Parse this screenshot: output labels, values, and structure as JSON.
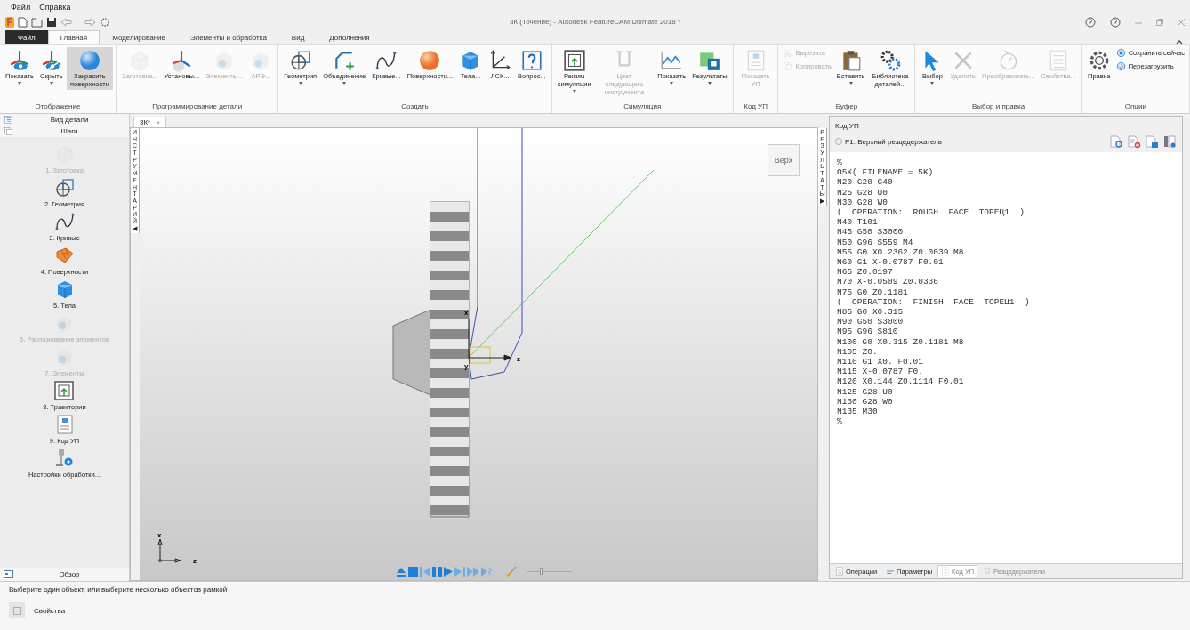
{
  "menu": [
    "Файл",
    "Справка"
  ],
  "window": {
    "title": "3К (Точение) - Autodesk FeatureCAM Ultimate 2018 *"
  },
  "ribbon_tabs": [
    {
      "label": "Файл",
      "kind": "file",
      "selected": false
    },
    {
      "label": "Главная",
      "kind": "tab",
      "selected": true
    },
    {
      "label": "Моделирование",
      "kind": "tab",
      "selected": false
    },
    {
      "label": "Элементы и обработка",
      "kind": "tab",
      "selected": false
    },
    {
      "label": "Вид",
      "kind": "tab",
      "selected": false
    },
    {
      "label": "Дополнения",
      "kind": "tab",
      "selected": false
    }
  ],
  "ribbon_groups": [
    {
      "label": "Отображение",
      "buttons": [
        {
          "label": "Показать",
          "kind": "large",
          "dropdown": true,
          "disabled": false,
          "pressed": false
        },
        {
          "label": "Скрыть",
          "kind": "large",
          "dropdown": true,
          "disabled": false,
          "pressed": false
        },
        {
          "label": "Закрасить поверхности",
          "kind": "large",
          "dropdown": false,
          "disabled": false,
          "pressed": true
        }
      ]
    },
    {
      "label": "Программирование детали",
      "buttons": [
        {
          "label": "Заготовка...",
          "kind": "large",
          "dropdown": false,
          "disabled": true,
          "pressed": false
        },
        {
          "label": "Установы...",
          "kind": "large",
          "dropdown": false,
          "disabled": false,
          "pressed": false
        },
        {
          "label": "Элементы...",
          "kind": "large",
          "dropdown": false,
          "disabled": true,
          "pressed": false
        },
        {
          "label": "АРЭ...",
          "kind": "large",
          "dropdown": false,
          "disabled": true,
          "pressed": false
        }
      ]
    },
    {
      "label": "Создать",
      "buttons": [
        {
          "label": "Геометрия",
          "kind": "large",
          "dropdown": true,
          "disabled": false,
          "pressed": false
        },
        {
          "label": "Объединение",
          "kind": "large",
          "dropdown": true,
          "disabled": false,
          "pressed": false
        },
        {
          "label": "Кривые...",
          "kind": "large",
          "dropdown": false,
          "disabled": false,
          "pressed": false
        },
        {
          "label": "Поверхности...",
          "kind": "large",
          "dropdown": false,
          "disabled": false,
          "pressed": false
        },
        {
          "label": "Тела...",
          "kind": "large",
          "dropdown": false,
          "disabled": false,
          "pressed": false
        },
        {
          "label": "ЛСК...",
          "kind": "large",
          "dropdown": false,
          "disabled": false,
          "pressed": false
        },
        {
          "label": "Вопрос...",
          "kind": "large",
          "dropdown": false,
          "disabled": false,
          "pressed": false
        }
      ]
    },
    {
      "label": "Симуляция",
      "buttons": [
        {
          "label": "Режим симуляции",
          "kind": "large",
          "dropdown": true,
          "disabled": false,
          "pressed": false
        },
        {
          "label": "Цвет следующего инструмента",
          "kind": "large",
          "dropdown": false,
          "disabled": true,
          "pressed": false
        },
        {
          "label": "Показать",
          "kind": "large",
          "dropdown": true,
          "disabled": false,
          "pressed": false
        },
        {
          "label": "Результаты",
          "kind": "large",
          "dropdown": true,
          "disabled": false,
          "pressed": false
        }
      ]
    },
    {
      "label": "Код УП",
      "buttons": [
        {
          "label": "Показать УП",
          "kind": "large",
          "dropdown": false,
          "disabled": true,
          "pressed": false
        }
      ]
    },
    {
      "label": "Буфер",
      "buttons": [
        {
          "label": "Вырезать",
          "kind": "small",
          "dropdown": false,
          "disabled": true,
          "pressed": false
        },
        {
          "label": "Копировать",
          "kind": "small",
          "dropdown": false,
          "disabled": true,
          "pressed": false
        },
        {
          "label": "Вставить",
          "kind": "large",
          "dropdown": true,
          "disabled": false,
          "pressed": false
        },
        {
          "label": "Библиотека деталей...",
          "kind": "large",
          "dropdown": false,
          "disabled": false,
          "pressed": false
        }
      ]
    },
    {
      "label": "Выбор и правка",
      "buttons": [
        {
          "label": "Выбор",
          "kind": "large",
          "dropdown": true,
          "disabled": false,
          "pressed": false
        },
        {
          "label": "Удалить",
          "kind": "large",
          "dropdown": false,
          "disabled": true,
          "pressed": false
        },
        {
          "label": "Преобразовать...",
          "kind": "large",
          "dropdown": false,
          "disabled": true,
          "pressed": false
        },
        {
          "label": "Свойства...",
          "kind": "large",
          "dropdown": false,
          "disabled": true,
          "pressed": false
        }
      ]
    },
    {
      "label": "Опции",
      "buttons": [
        {
          "label": "Правка",
          "kind": "large",
          "dropdown": false,
          "disabled": false,
          "pressed": false
        },
        {
          "label": "Сохранить сейчас",
          "kind": "small",
          "dropdown": false,
          "disabled": false,
          "pressed": false
        },
        {
          "label": "Перезагрузить",
          "kind": "small",
          "dropdown": false,
          "disabled": false,
          "pressed": false
        }
      ]
    }
  ],
  "sidebar": {
    "header_items": [
      "Вид детали",
      "Шаги"
    ],
    "steps": [
      {
        "label": "1. Заготовка",
        "disabled": true
      },
      {
        "label": "2. Геометрия",
        "disabled": false
      },
      {
        "label": "3. Кривые",
        "disabled": false
      },
      {
        "label": "4. Поверхности",
        "disabled": false
      },
      {
        "label": "5. Тела",
        "disabled": false
      },
      {
        "label": "6. Распознавание элементов",
        "disabled": true
      },
      {
        "label": "7. Элементы",
        "disabled": true
      },
      {
        "label": "8. Траектории",
        "disabled": false
      },
      {
        "label": "9. Код УП",
        "disabled": false
      },
      {
        "label": "Настройки обработки...",
        "disabled": false
      }
    ],
    "footer": "Обзор"
  },
  "document_tab": {
    "label": "3К*",
    "close": "×"
  },
  "toolbox_tab": {
    "label": "ИНСТРУМЕНТАРИЙ",
    "arrow": "◀"
  },
  "viewport": {
    "view_button": "Верх",
    "part_axes": [
      "x",
      "y",
      "z"
    ],
    "triad_axes": [
      "x",
      "z"
    ],
    "speed_slider": {
      "level": 0.3
    }
  },
  "results_tab": {
    "label": "РЕЗУЛЬТАТЫ",
    "arrow": "▶"
  },
  "nc_panel": {
    "title": "Код УП",
    "radio": {
      "label": "P1: Верхний резцедержатель",
      "checked": false
    },
    "lines": [
      "%",
      "O5K( FILENAME = 5K)",
      "N20 G20 G40",
      "N25 G28 U0",
      "N30 G28 W0",
      "(  OPERATION:  ROUGH  FACE  ТОРЕЦ1  )",
      "N40 T101",
      "N45 G50 S3000",
      "N50 G96 S559 M4",
      "N55 G0 X0.2362 Z0.0039 M8",
      "N60 G1 X-0.0787 F0.01",
      "N65 Z0.0197",
      "N70 X-0.0509 Z0.0336",
      "N75 G0 Z0.1181",
      "(  OPERATION:  FINISH  FACE  ТОРЕЦ1  )",
      "N85 G0 X0.315",
      "N90 G50 S3000",
      "N95 G96 S810",
      "N100 G0 X0.315 Z0.1181 M8",
      "N105 Z0.",
      "N110 G1 X0. F0.01",
      "N115 X-0.0787 F0.",
      "N120 X0.144 Z0.1114 F0.01",
      "N125 G28 U0",
      "N130 G28 W0",
      "N135 M30",
      "%"
    ],
    "tabs": [
      {
        "label": "Операции",
        "selected": false,
        "disabled": false
      },
      {
        "label": "Параметры",
        "selected": false,
        "disabled": false
      },
      {
        "label": "Код УП",
        "selected": true,
        "disabled": false
      },
      {
        "label": "Резцедержатели",
        "selected": false,
        "disabled": true
      }
    ]
  },
  "status": {
    "hint": "Выберите один объект, или выберите несколько объектов рамкой",
    "properties": "Свойства"
  }
}
